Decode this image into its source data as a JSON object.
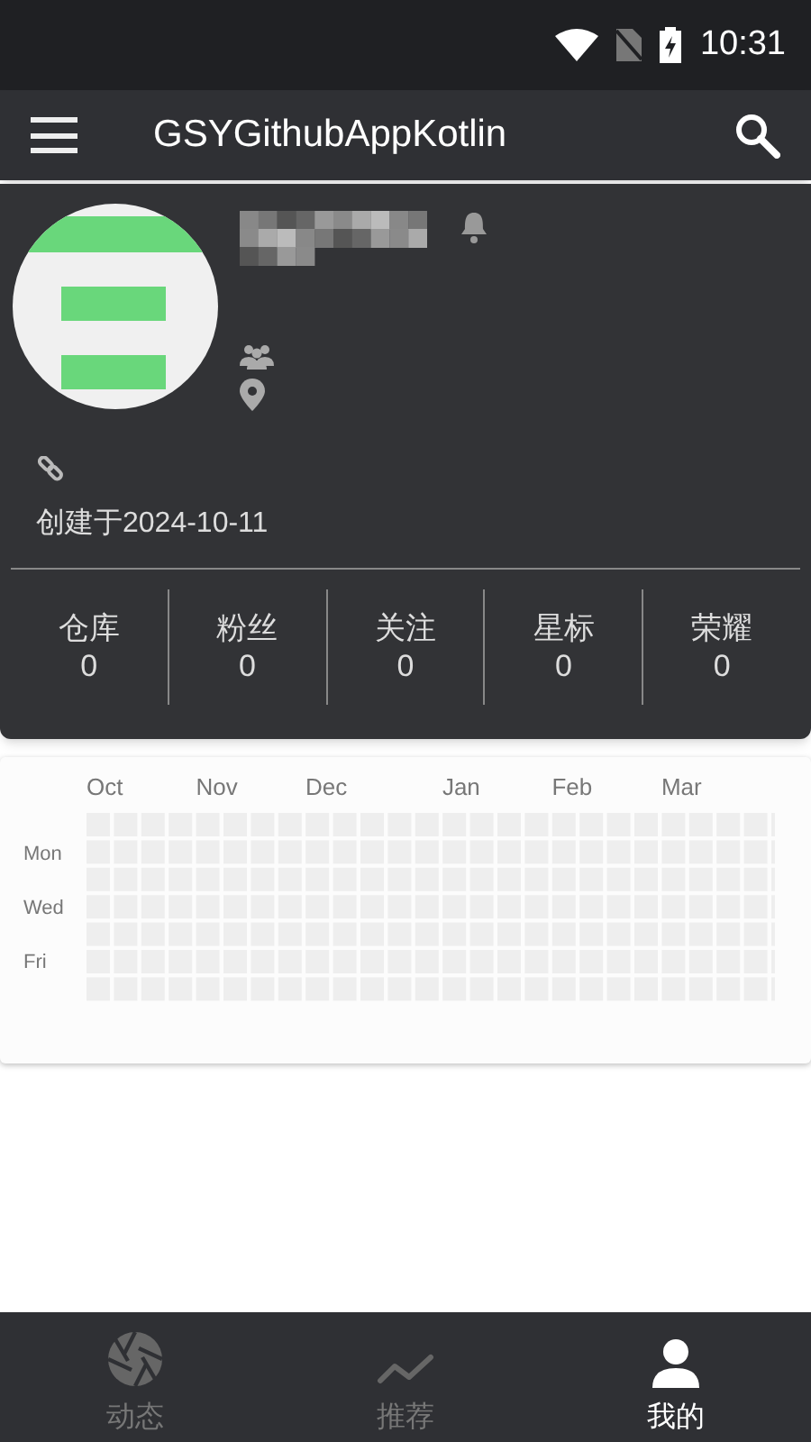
{
  "status_bar": {
    "time": "10:31"
  },
  "app_bar": {
    "title": "GSYGithubAppKotlin"
  },
  "profile": {
    "created": "创建于2024-10-11"
  },
  "stats": [
    {
      "label": "仓库",
      "value": "0"
    },
    {
      "label": "粉丝",
      "value": "0"
    },
    {
      "label": "关注",
      "value": "0"
    },
    {
      "label": "星标",
      "value": "0"
    },
    {
      "label": "荣耀",
      "value": "0"
    }
  ],
  "contributions": {
    "months": [
      "Oct",
      "Nov",
      "Dec",
      "Jan",
      "Feb",
      "Mar"
    ],
    "days": [
      "Mon",
      "Wed",
      "Fri"
    ]
  },
  "bottom_nav": [
    {
      "kind": "feed",
      "label": "动态",
      "selected": false
    },
    {
      "kind": "trend",
      "label": "推荐",
      "selected": false
    },
    {
      "kind": "mine",
      "label": "我的",
      "selected": true
    }
  ]
}
